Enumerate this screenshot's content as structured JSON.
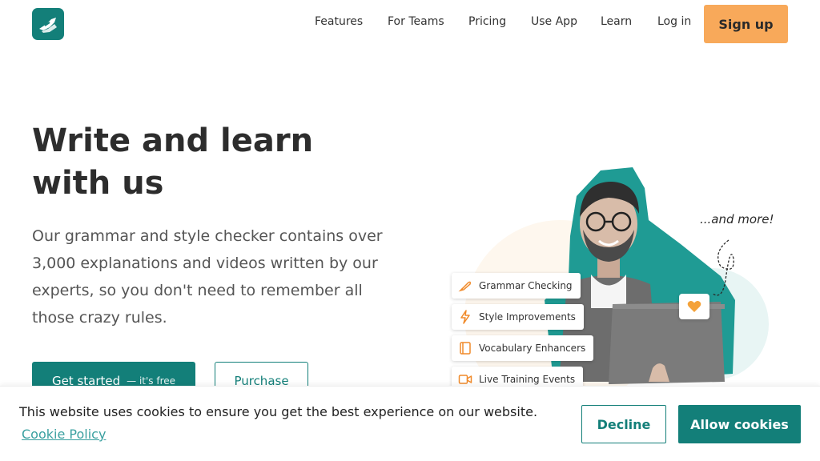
{
  "header": {
    "logo_icon": "writing-check-logo-icon",
    "nav": [
      {
        "label": "Features"
      },
      {
        "label": "For Teams"
      },
      {
        "label": "Pricing"
      },
      {
        "label": "Use App"
      },
      {
        "label": "Learn"
      },
      {
        "label": "Log in"
      }
    ],
    "signup_label": "Sign up"
  },
  "hero": {
    "title": "Write and learn with us",
    "subtitle": "Our grammar and style checker contains over 3,000 explanations and videos written by our experts, so you don't need to remember all those crazy rules.",
    "primary_button": {
      "label": "Get started",
      "suffix": "— it's free"
    },
    "secondary_button": {
      "label": "Purchase"
    }
  },
  "illustration": {
    "features": [
      {
        "label": "Grammar Checking",
        "icon": "feather-icon"
      },
      {
        "label": "Style Improvements",
        "icon": "lightning-icon"
      },
      {
        "label": "Vocabulary Enhancers",
        "icon": "book-icon"
      },
      {
        "label": "Live Training Events",
        "icon": "video-camera-icon"
      }
    ],
    "more_label": "...and more!",
    "heart_icon": "heart-icon"
  },
  "cookie": {
    "text": "This website uses cookies to ensure you get the best experience on our website.",
    "link_label": "Cookie Policy",
    "decline_label": "Decline",
    "allow_label": "Allow cookies"
  },
  "colors": {
    "brand_teal": "#137f79",
    "accent_orange": "#f8a95a",
    "link_teal": "#3aa0a0"
  }
}
